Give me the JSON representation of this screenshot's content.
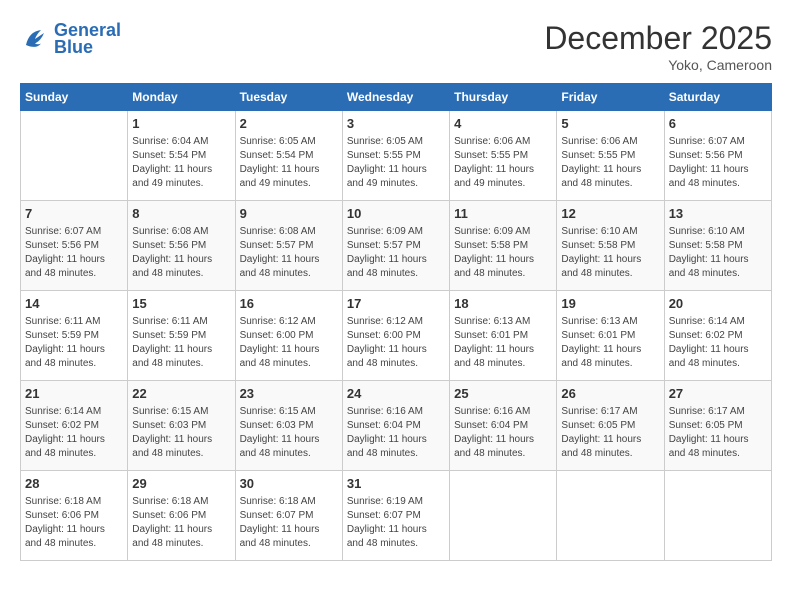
{
  "header": {
    "logo_line1": "General",
    "logo_line2": "Blue",
    "month": "December 2025",
    "location": "Yoko, Cameroon"
  },
  "days_of_week": [
    "Sunday",
    "Monday",
    "Tuesday",
    "Wednesday",
    "Thursday",
    "Friday",
    "Saturday"
  ],
  "weeks": [
    [
      {
        "day": "",
        "sunrise": "",
        "sunset": "",
        "daylight": ""
      },
      {
        "day": "1",
        "sunrise": "Sunrise: 6:04 AM",
        "sunset": "Sunset: 5:54 PM",
        "daylight": "Daylight: 11 hours and 49 minutes."
      },
      {
        "day": "2",
        "sunrise": "Sunrise: 6:05 AM",
        "sunset": "Sunset: 5:54 PM",
        "daylight": "Daylight: 11 hours and 49 minutes."
      },
      {
        "day": "3",
        "sunrise": "Sunrise: 6:05 AM",
        "sunset": "Sunset: 5:55 PM",
        "daylight": "Daylight: 11 hours and 49 minutes."
      },
      {
        "day": "4",
        "sunrise": "Sunrise: 6:06 AM",
        "sunset": "Sunset: 5:55 PM",
        "daylight": "Daylight: 11 hours and 49 minutes."
      },
      {
        "day": "5",
        "sunrise": "Sunrise: 6:06 AM",
        "sunset": "Sunset: 5:55 PM",
        "daylight": "Daylight: 11 hours and 48 minutes."
      },
      {
        "day": "6",
        "sunrise": "Sunrise: 6:07 AM",
        "sunset": "Sunset: 5:56 PM",
        "daylight": "Daylight: 11 hours and 48 minutes."
      }
    ],
    [
      {
        "day": "7",
        "sunrise": "Sunrise: 6:07 AM",
        "sunset": "Sunset: 5:56 PM",
        "daylight": "Daylight: 11 hours and 48 minutes."
      },
      {
        "day": "8",
        "sunrise": "Sunrise: 6:08 AM",
        "sunset": "Sunset: 5:56 PM",
        "daylight": "Daylight: 11 hours and 48 minutes."
      },
      {
        "day": "9",
        "sunrise": "Sunrise: 6:08 AM",
        "sunset": "Sunset: 5:57 PM",
        "daylight": "Daylight: 11 hours and 48 minutes."
      },
      {
        "day": "10",
        "sunrise": "Sunrise: 6:09 AM",
        "sunset": "Sunset: 5:57 PM",
        "daylight": "Daylight: 11 hours and 48 minutes."
      },
      {
        "day": "11",
        "sunrise": "Sunrise: 6:09 AM",
        "sunset": "Sunset: 5:58 PM",
        "daylight": "Daylight: 11 hours and 48 minutes."
      },
      {
        "day": "12",
        "sunrise": "Sunrise: 6:10 AM",
        "sunset": "Sunset: 5:58 PM",
        "daylight": "Daylight: 11 hours and 48 minutes."
      },
      {
        "day": "13",
        "sunrise": "Sunrise: 6:10 AM",
        "sunset": "Sunset: 5:58 PM",
        "daylight": "Daylight: 11 hours and 48 minutes."
      }
    ],
    [
      {
        "day": "14",
        "sunrise": "Sunrise: 6:11 AM",
        "sunset": "Sunset: 5:59 PM",
        "daylight": "Daylight: 11 hours and 48 minutes."
      },
      {
        "day": "15",
        "sunrise": "Sunrise: 6:11 AM",
        "sunset": "Sunset: 5:59 PM",
        "daylight": "Daylight: 11 hours and 48 minutes."
      },
      {
        "day": "16",
        "sunrise": "Sunrise: 6:12 AM",
        "sunset": "Sunset: 6:00 PM",
        "daylight": "Daylight: 11 hours and 48 minutes."
      },
      {
        "day": "17",
        "sunrise": "Sunrise: 6:12 AM",
        "sunset": "Sunset: 6:00 PM",
        "daylight": "Daylight: 11 hours and 48 minutes."
      },
      {
        "day": "18",
        "sunrise": "Sunrise: 6:13 AM",
        "sunset": "Sunset: 6:01 PM",
        "daylight": "Daylight: 11 hours and 48 minutes."
      },
      {
        "day": "19",
        "sunrise": "Sunrise: 6:13 AM",
        "sunset": "Sunset: 6:01 PM",
        "daylight": "Daylight: 11 hours and 48 minutes."
      },
      {
        "day": "20",
        "sunrise": "Sunrise: 6:14 AM",
        "sunset": "Sunset: 6:02 PM",
        "daylight": "Daylight: 11 hours and 48 minutes."
      }
    ],
    [
      {
        "day": "21",
        "sunrise": "Sunrise: 6:14 AM",
        "sunset": "Sunset: 6:02 PM",
        "daylight": "Daylight: 11 hours and 48 minutes."
      },
      {
        "day": "22",
        "sunrise": "Sunrise: 6:15 AM",
        "sunset": "Sunset: 6:03 PM",
        "daylight": "Daylight: 11 hours and 48 minutes."
      },
      {
        "day": "23",
        "sunrise": "Sunrise: 6:15 AM",
        "sunset": "Sunset: 6:03 PM",
        "daylight": "Daylight: 11 hours and 48 minutes."
      },
      {
        "day": "24",
        "sunrise": "Sunrise: 6:16 AM",
        "sunset": "Sunset: 6:04 PM",
        "daylight": "Daylight: 11 hours and 48 minutes."
      },
      {
        "day": "25",
        "sunrise": "Sunrise: 6:16 AM",
        "sunset": "Sunset: 6:04 PM",
        "daylight": "Daylight: 11 hours and 48 minutes."
      },
      {
        "day": "26",
        "sunrise": "Sunrise: 6:17 AM",
        "sunset": "Sunset: 6:05 PM",
        "daylight": "Daylight: 11 hours and 48 minutes."
      },
      {
        "day": "27",
        "sunrise": "Sunrise: 6:17 AM",
        "sunset": "Sunset: 6:05 PM",
        "daylight": "Daylight: 11 hours and 48 minutes."
      }
    ],
    [
      {
        "day": "28",
        "sunrise": "Sunrise: 6:18 AM",
        "sunset": "Sunset: 6:06 PM",
        "daylight": "Daylight: 11 hours and 48 minutes."
      },
      {
        "day": "29",
        "sunrise": "Sunrise: 6:18 AM",
        "sunset": "Sunset: 6:06 PM",
        "daylight": "Daylight: 11 hours and 48 minutes."
      },
      {
        "day": "30",
        "sunrise": "Sunrise: 6:18 AM",
        "sunset": "Sunset: 6:07 PM",
        "daylight": "Daylight: 11 hours and 48 minutes."
      },
      {
        "day": "31",
        "sunrise": "Sunrise: 6:19 AM",
        "sunset": "Sunset: 6:07 PM",
        "daylight": "Daylight: 11 hours and 48 minutes."
      },
      {
        "day": "",
        "sunrise": "",
        "sunset": "",
        "daylight": ""
      },
      {
        "day": "",
        "sunrise": "",
        "sunset": "",
        "daylight": ""
      },
      {
        "day": "",
        "sunrise": "",
        "sunset": "",
        "daylight": ""
      }
    ]
  ]
}
